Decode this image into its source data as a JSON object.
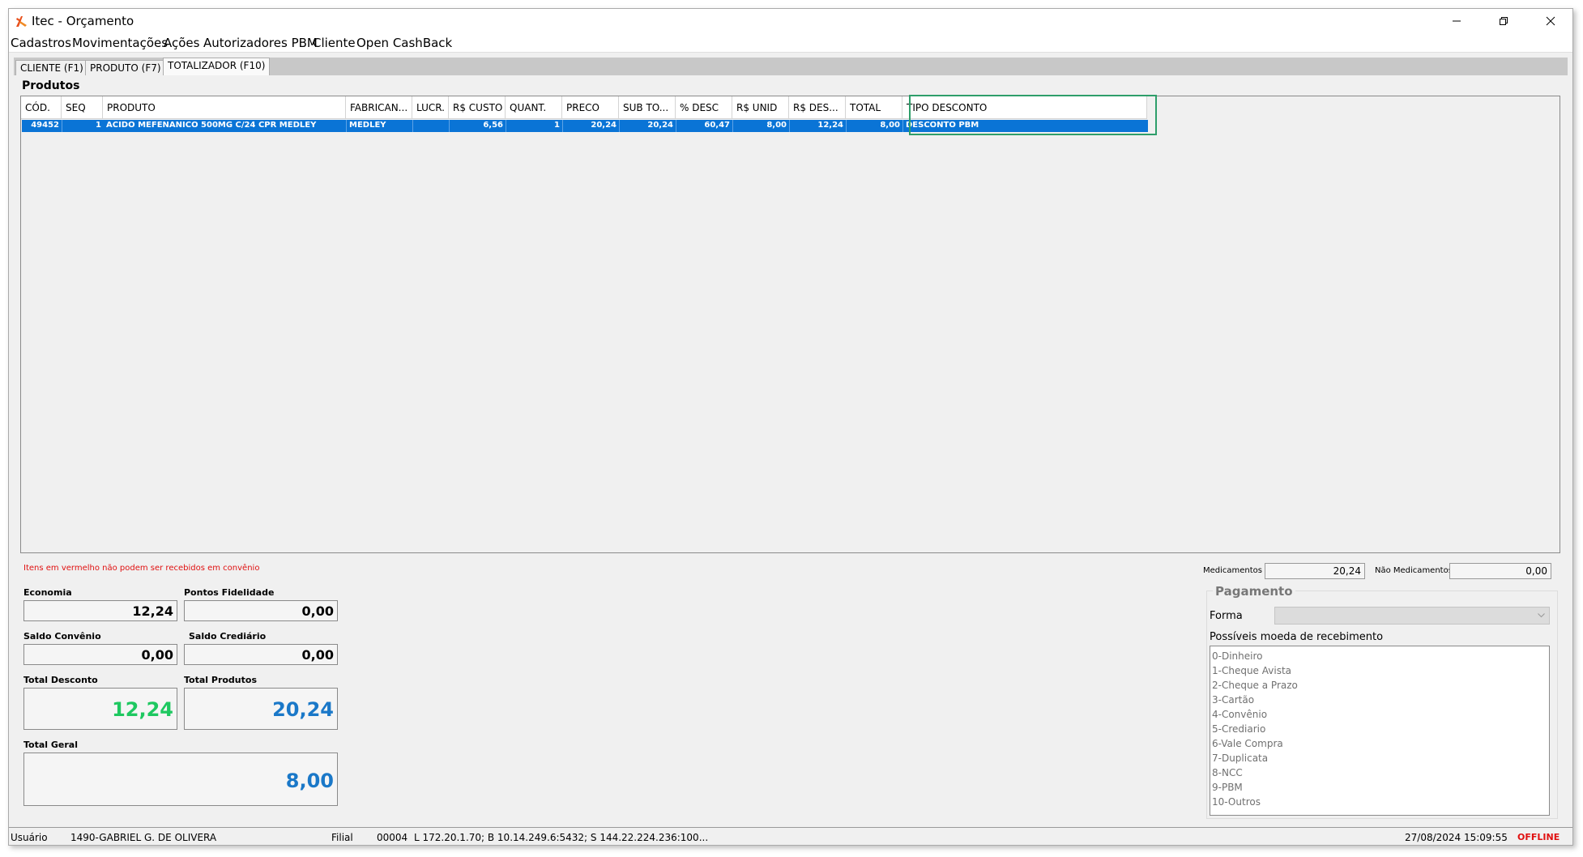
{
  "window": {
    "title": "Itec - Orçamento"
  },
  "menu": [
    "Cadastros",
    "Movimentações",
    "Ações",
    "Autorizadores PBM",
    "Cliente",
    "Open CashBack"
  ],
  "tabs": [
    {
      "label": "CLIENTE (F1)",
      "active": false
    },
    {
      "label": "PRODUTO (F7)",
      "active": false
    },
    {
      "label": "TOTALIZADOR (F10)",
      "active": true
    }
  ],
  "produtos": {
    "title": "Produtos",
    "columns": [
      "CÓD.",
      "SEQ",
      "PRODUTO",
      "FABRICAN...",
      "LUCR.",
      "R$ CUSTO",
      "QUANT.",
      "PRECO",
      "SUB TO...",
      "% DESC",
      "R$ UNID",
      "R$ DES...",
      "TOTAL",
      "TIPO DESCONTO"
    ],
    "rows": [
      [
        "49452",
        "1",
        "ACIDO MEFENANICO 500MG C/24 CPR MEDLEY",
        "MEDLEY",
        "",
        "6,56",
        "1",
        "20,24",
        "20,24",
        "60,47",
        "8,00",
        "12,24",
        "8,00",
        "DESCONTO PBM"
      ]
    ],
    "highlight_color": "#2e9e6a"
  },
  "warning": "Itens em vermelho não podem ser recebidos em convênio",
  "totals": {
    "economia_label": "Economia",
    "economia": "12,24",
    "pontos_label": "Pontos Fidelidade",
    "pontos": "0,00",
    "saldo_convenio_label": "Saldo Convênio",
    "saldo_convenio": "0,00",
    "saldo_crediario_label": "Saldo Crediário",
    "saldo_crediario": "0,00",
    "total_desconto_label": "Total Desconto",
    "total_desconto": "12,24",
    "total_produtos_label": "Total Produtos",
    "total_produtos": "20,24",
    "total_geral_label": "Total Geral",
    "total_geral": "8,00",
    "green": "#1ec860",
    "blue": "#1a78c8"
  },
  "medicamentos": {
    "med_label": "Medicamentos",
    "med_value": "20,24",
    "nao_med_label": "Não Medicamentos",
    "nao_med_value": "0,00"
  },
  "pagamento": {
    "title": "Pagamento",
    "forma_label": "Forma",
    "moedas_label": "Possíveis moeda de recebimento",
    "moedas": [
      "0-Dinheiro",
      "1-Cheque Avista",
      "2-Cheque a Prazo",
      "3-Cartão",
      "4-Convênio",
      "5-Crediario",
      "6-Vale Compra",
      "7-Duplicata",
      "8-NCC",
      "9-PBM",
      "10-Outros"
    ]
  },
  "status": {
    "usuario_label": "Usuário",
    "usuario": "1490-GABRIEL G. DE OLIVERA",
    "filial_label": "Filial",
    "filial": "00004",
    "conexao": "L 172.20.1.70; B 10.14.249.6:5432; S 144.22.224.236:100...",
    "datetime": "27/08/2024 15:09:55",
    "state": "OFFLINE",
    "state_color": "#e01010"
  }
}
